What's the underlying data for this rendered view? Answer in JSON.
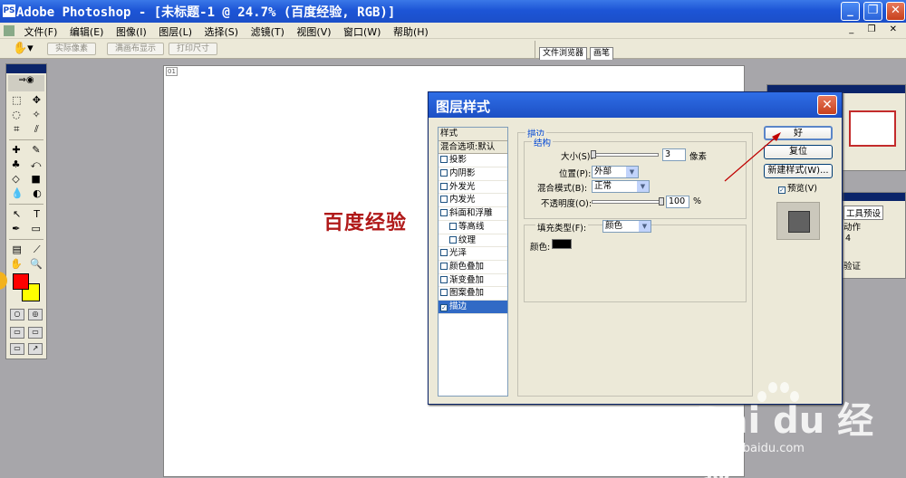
{
  "window": {
    "title": "Adobe Photoshop - [未标题-1 @ 24.7% (百度经验, RGB)]",
    "app_icon": "PS"
  },
  "menubar": {
    "items": [
      "文件(F)",
      "编辑(E)",
      "图像(I)",
      "图层(L)",
      "选择(S)",
      "滤镜(T)",
      "视图(V)",
      "窗口(W)",
      "帮助(H)"
    ]
  },
  "optionsbar": {
    "buttons": [
      "实际像素",
      "满画布显示",
      "打印尺寸"
    ],
    "tabs": [
      "文件浏览器",
      "画笔"
    ]
  },
  "document": {
    "canvas_text": "百度经验",
    "corner_tag": "01"
  },
  "palettes": {
    "tool_preset_tab": "工具预设",
    "actions_label": "动作",
    "actions_num": "4",
    "actions_item": "验证"
  },
  "dialog": {
    "title": "图层样式",
    "styles_header": "样式",
    "blend_option": "混合选项:默认",
    "style_items": [
      {
        "label": "投影",
        "checked": false,
        "indent": false
      },
      {
        "label": "内阴影",
        "checked": false,
        "indent": false
      },
      {
        "label": "外发光",
        "checked": false,
        "indent": false
      },
      {
        "label": "内发光",
        "checked": false,
        "indent": false
      },
      {
        "label": "斜面和浮雕",
        "checked": false,
        "indent": false
      },
      {
        "label": "等高线",
        "checked": false,
        "indent": true
      },
      {
        "label": "纹理",
        "checked": false,
        "indent": true
      },
      {
        "label": "光泽",
        "checked": false,
        "indent": false
      },
      {
        "label": "颜色叠加",
        "checked": false,
        "indent": false
      },
      {
        "label": "渐变叠加",
        "checked": false,
        "indent": false
      },
      {
        "label": "图案叠加",
        "checked": false,
        "indent": false
      },
      {
        "label": "描边",
        "checked": true,
        "indent": false
      }
    ],
    "section_title": "描边",
    "structure_title": "结构",
    "size_label": "大小(S):",
    "size_value": "3",
    "size_unit": "像素",
    "position_label": "位置(P):",
    "position_value": "外部",
    "blend_mode_label": "混合模式(B):",
    "blend_mode_value": "正常",
    "opacity_label": "不透明度(O):",
    "opacity_value": "100",
    "opacity_unit": "%",
    "fill_type_label": "填充类型(F):",
    "fill_type_value": "颜色",
    "color_label": "颜色:",
    "stroke_color": "#000000",
    "ok": "好",
    "reset": "复位",
    "new_style": "新建样式(W)...",
    "preview_label": "预览(V)",
    "preview_checked": true
  },
  "watermark": {
    "brand": "Bai du 经验",
    "url": "jingyan.baidu.com"
  }
}
